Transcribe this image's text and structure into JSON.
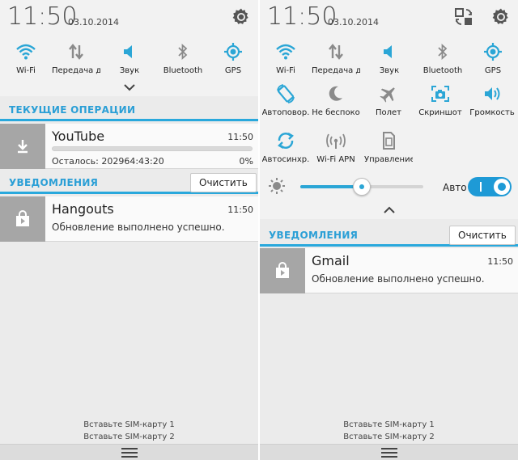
{
  "left": {
    "time": "11:50",
    "date": "03.10.2014",
    "quick_settings": [
      {
        "label": "Wi-Fi",
        "icon": "wifi-icon",
        "active": true
      },
      {
        "label": "Передача д",
        "icon": "data-transfer-icon",
        "active": false
      },
      {
        "label": "Звук",
        "icon": "sound-icon",
        "active": true
      },
      {
        "label": "Bluetooth",
        "icon": "bluetooth-icon",
        "active": false
      },
      {
        "label": "GPS",
        "icon": "gps-icon",
        "active": true
      }
    ],
    "ongoing": {
      "title": "ТЕКУЩИЕ ОПЕРАЦИИ",
      "item": {
        "app": "YouTube",
        "time": "11:50",
        "status": "Осталось: 202964:43:20",
        "percent": "0%",
        "progress": 0
      }
    },
    "notifications": {
      "title": "УВЕДОМЛЕНИЯ",
      "clear_label": "Очистить",
      "items": [
        {
          "app": "Hangouts",
          "time": "11:50",
          "text": "Обновление выполнено успешно."
        }
      ]
    },
    "sim": [
      "Вставьте SIM-карту 1",
      "Вставьте SIM-карту 2"
    ]
  },
  "right": {
    "time": "11:50",
    "date": "03.10.2014",
    "row1": [
      {
        "label": "Wi-Fi",
        "icon": "wifi-icon",
        "active": true
      },
      {
        "label": "Передача д",
        "icon": "data-transfer-icon",
        "active": false
      },
      {
        "label": "Звук",
        "icon": "sound-icon",
        "active": true
      },
      {
        "label": "Bluetooth",
        "icon": "bluetooth-icon",
        "active": false
      },
      {
        "label": "GPS",
        "icon": "gps-icon",
        "active": true
      }
    ],
    "row2": [
      {
        "label": "Автоповор.",
        "icon": "auto-rotate-icon",
        "active": true
      },
      {
        "label": "Не беспоко",
        "icon": "moon-icon",
        "active": false
      },
      {
        "label": "Полет",
        "icon": "airplane-icon",
        "active": false
      },
      {
        "label": "Скриншот",
        "icon": "screenshot-icon",
        "active": true
      },
      {
        "label": "Громкость",
        "icon": "volume-icon",
        "active": true
      }
    ],
    "row3": [
      {
        "label": "Автосинхр.",
        "icon": "sync-icon",
        "active": true
      },
      {
        "label": "Wi-Fi APN",
        "icon": "wifi-apn-icon",
        "active": false
      },
      {
        "label": "Управление",
        "icon": "sim-management-icon",
        "active": false
      }
    ],
    "brightness": {
      "auto_label": "Авто",
      "level": 0.5,
      "auto": true
    },
    "notifications": {
      "title": "УВЕДОМЛЕНИЯ",
      "clear_label": "Очистить",
      "items": [
        {
          "app": "Gmail",
          "time": "11:50",
          "text": "Обновление выполнено успешно."
        }
      ]
    },
    "sim": [
      "Вставьте SIM-карту 1",
      "Вставьте SIM-карту 2"
    ]
  },
  "colors": {
    "accent": "#2ba6d6",
    "inactive": "#8a8a8a",
    "icon_box": "#a6a6a6"
  }
}
